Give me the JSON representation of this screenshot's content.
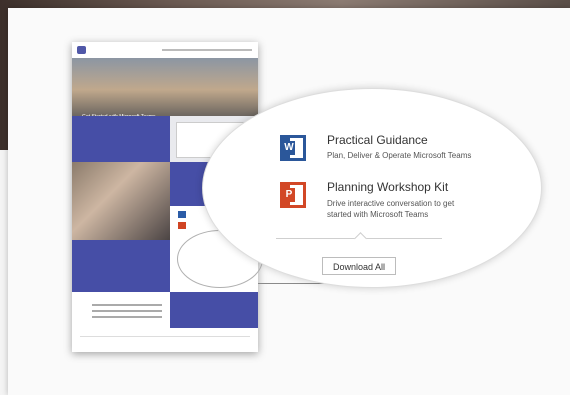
{
  "resources": [
    {
      "title": "Practical Guidance",
      "description": "Plan, Deliver & Operate Microsoft Teams",
      "icon": "word-icon"
    },
    {
      "title": "Planning Workshop Kit",
      "description": "Drive interactive conversation to get started with Microsoft Teams",
      "icon": "powerpoint-icon"
    }
  ],
  "download_all_label": "Download All",
  "doc_preview": {
    "hero_title": "Get Started with Microsoft Teams"
  },
  "colors": {
    "teams_purple": "#464ea6",
    "word_blue": "#2b579a",
    "powerpoint_orange": "#d24726"
  }
}
